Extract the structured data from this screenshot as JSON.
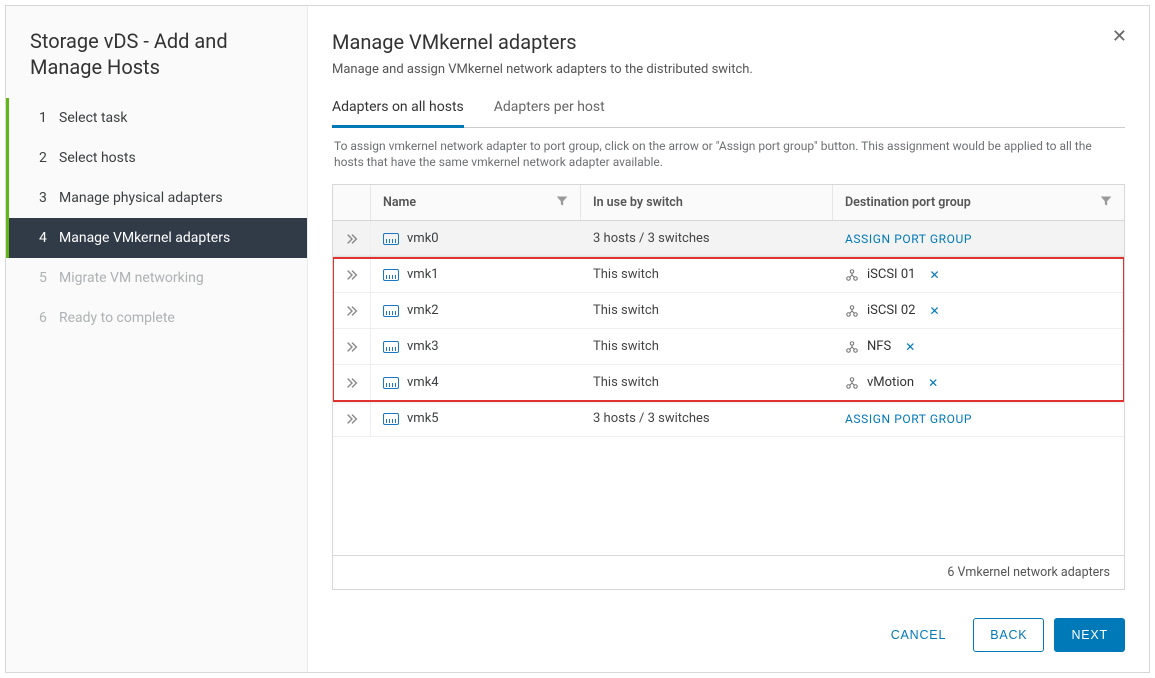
{
  "wizard_title": "Storage vDS - Add and Manage Hosts",
  "steps": [
    {
      "num": "1",
      "label": "Select task",
      "state": "completed"
    },
    {
      "num": "2",
      "label": "Select hosts",
      "state": "completed"
    },
    {
      "num": "3",
      "label": "Manage physical adapters",
      "state": "completed"
    },
    {
      "num": "4",
      "label": "Manage VMkernel adapters",
      "state": "active"
    },
    {
      "num": "5",
      "label": "Migrate VM networking",
      "state": "future"
    },
    {
      "num": "6",
      "label": "Ready to complete",
      "state": "future"
    }
  ],
  "page_header": "Manage VMkernel adapters",
  "page_subtitle": "Manage and assign VMkernel network adapters to the distributed switch.",
  "tabs": [
    {
      "label": "Adapters on all hosts",
      "active": true
    },
    {
      "label": "Adapters per host",
      "active": false
    }
  ],
  "help_text": "To assign vmkernel network adapter to port group, click on the arrow or \"Assign port group\" button. This assignment would be applied to all the hosts that have the same vmkernel network adapter available.",
  "columns": {
    "name": "Name",
    "in_use": "In use by switch",
    "dest": "Destination port group"
  },
  "assign_label": "ASSIGN PORT GROUP",
  "rows": [
    {
      "name": "vmk0",
      "in_use": "3 hosts / 3 switches",
      "dest": null,
      "highlighted": false
    },
    {
      "name": "vmk1",
      "in_use": "This switch",
      "dest": "iSCSI 01",
      "highlighted": true
    },
    {
      "name": "vmk2",
      "in_use": "This switch",
      "dest": "iSCSI 02",
      "highlighted": true
    },
    {
      "name": "vmk3",
      "in_use": "This switch",
      "dest": "NFS",
      "highlighted": true
    },
    {
      "name": "vmk4",
      "in_use": "This switch",
      "dest": "vMotion",
      "highlighted": true
    },
    {
      "name": "vmk5",
      "in_use": "3 hosts / 3 switches",
      "dest": null,
      "highlighted": false
    }
  ],
  "footer_count": "6 Vmkernel network adapters",
  "buttons": {
    "cancel": "CANCEL",
    "back": "BACK",
    "next": "NEXT"
  }
}
